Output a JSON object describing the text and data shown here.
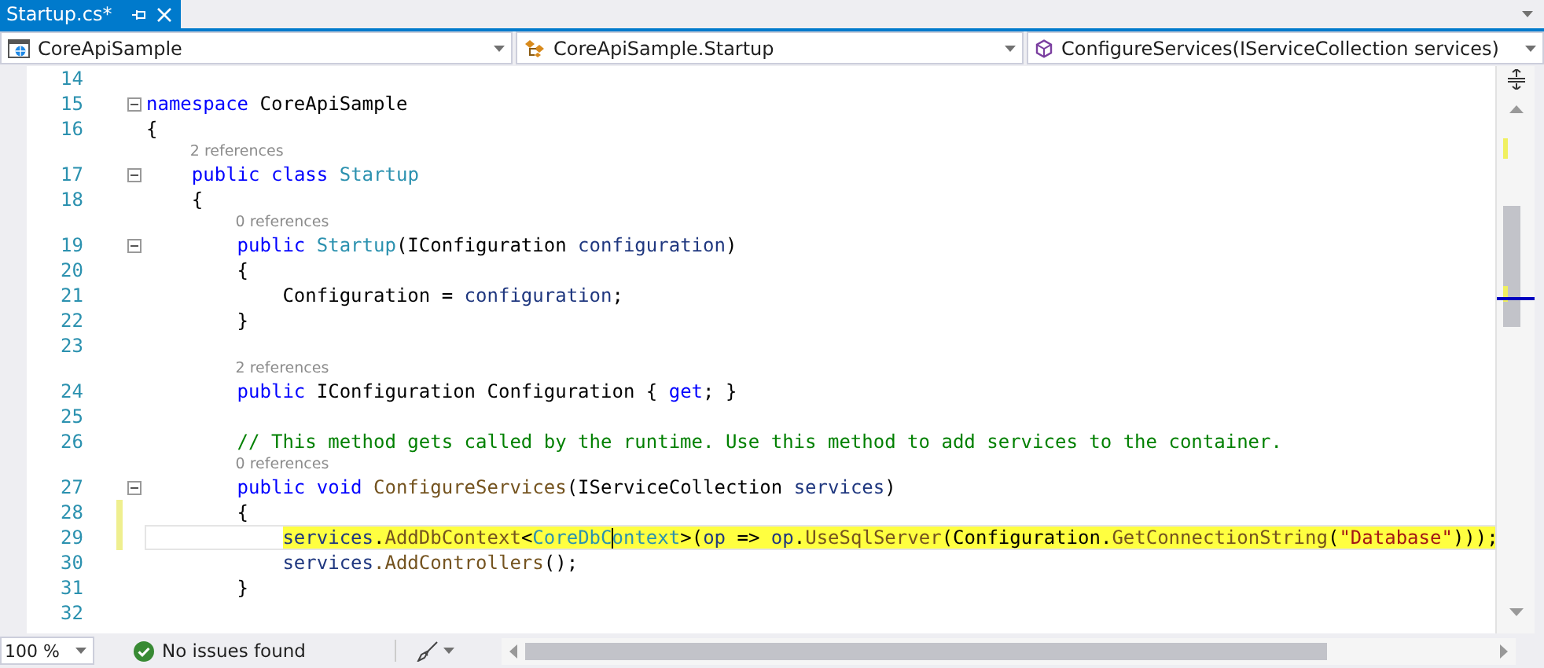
{
  "tab": {
    "title": "Startup.cs*",
    "selected": true
  },
  "navigation": [
    {
      "kind": "project",
      "text": "CoreApiSample"
    },
    {
      "kind": "class",
      "text": "CoreApiSample.Startup"
    },
    {
      "kind": "method",
      "text": "ConfigureServices(IServiceCollection services)"
    }
  ],
  "editor": {
    "lines": [
      {
        "kind": "code",
        "number": "14"
      },
      {
        "kind": "code",
        "number": "15",
        "fold": true,
        "tokens": [
          {
            "kind": "keyword",
            "text": "namespace"
          },
          {
            "kind": "plain",
            "text": " CoreApiSample"
          }
        ]
      },
      {
        "kind": "code",
        "number": "16",
        "tokens": [
          {
            "kind": "plain",
            "text": "{"
          }
        ]
      },
      {
        "kind": "lens",
        "text": "2 references"
      },
      {
        "kind": "code",
        "number": "17",
        "fold": true,
        "tokens": [
          {
            "kind": "keyword",
            "text": "    public"
          },
          {
            "kind": "keyword",
            "text": " class"
          },
          {
            "kind": "type",
            "text": " Startup"
          }
        ]
      },
      {
        "kind": "code",
        "number": "18",
        "tokens": [
          {
            "kind": "plain",
            "text": "    {"
          }
        ]
      },
      {
        "kind": "lens",
        "text": "0 references"
      },
      {
        "kind": "code",
        "number": "19",
        "fold": true,
        "tokens": [
          {
            "kind": "keyword",
            "text": "        public"
          },
          {
            "kind": "type",
            "text": " Startup"
          },
          {
            "kind": "plain",
            "text": "(IConfiguration "
          },
          {
            "kind": "param",
            "text": "configuration"
          },
          {
            "kind": "plain",
            "text": ")"
          }
        ]
      },
      {
        "kind": "code",
        "number": "20",
        "tokens": [
          {
            "kind": "plain",
            "text": "        {"
          }
        ]
      },
      {
        "kind": "code",
        "number": "21",
        "tokens": [
          {
            "kind": "plain",
            "text": "            Configuration = "
          },
          {
            "kind": "param",
            "text": "configuration"
          },
          {
            "kind": "plain",
            "text": ";"
          }
        ]
      },
      {
        "kind": "code",
        "number": "22",
        "tokens": [
          {
            "kind": "plain",
            "text": "        }"
          }
        ]
      },
      {
        "kind": "code",
        "number": "23"
      },
      {
        "kind": "lens",
        "text": "2 references"
      },
      {
        "kind": "code",
        "number": "24",
        "tokens": [
          {
            "kind": "keyword",
            "text": "        public"
          },
          {
            "kind": "plain",
            "text": " IConfiguration Configuration { "
          },
          {
            "kind": "keyword",
            "text": "get"
          },
          {
            "kind": "plain",
            "text": "; }"
          }
        ]
      },
      {
        "kind": "code",
        "number": "25"
      },
      {
        "kind": "code",
        "number": "26",
        "tokens": [
          {
            "kind": "comment",
            "text": "        // This method gets called by the runtime. Use this method to add services to the container."
          }
        ]
      },
      {
        "kind": "lens",
        "text": "0 references"
      },
      {
        "kind": "code",
        "number": "27",
        "fold": true,
        "tokens": [
          {
            "kind": "keyword",
            "text": "        public"
          },
          {
            "kind": "keyword",
            "text": " void"
          },
          {
            "kind": "method",
            "text": " ConfigureServices"
          },
          {
            "kind": "plain",
            "text": "(IServiceCollection "
          },
          {
            "kind": "param",
            "text": "services"
          },
          {
            "kind": "plain",
            "text": ")"
          }
        ]
      },
      {
        "kind": "code",
        "number": "28",
        "changed": true,
        "tokens": [
          {
            "kind": "plain",
            "text": "        {"
          }
        ]
      },
      {
        "kind": "code",
        "number": "29",
        "changed": true,
        "current": true,
        "marked": true,
        "tokens": [
          {
            "kind": "param",
            "text": "            services"
          },
          {
            "kind": "plain",
            "text": "."
          },
          {
            "kind": "method",
            "text": "AddDbContext"
          },
          {
            "kind": "plain",
            "text": "<"
          },
          {
            "kind": "type",
            "text": "CoreDbC"
          },
          {
            "kind": "type",
            "text": "ontext",
            "caret": true
          },
          {
            "kind": "plain",
            "text": ">("
          },
          {
            "kind": "param",
            "text": "op"
          },
          {
            "kind": "plain",
            "text": " => "
          },
          {
            "kind": "param",
            "text": "op"
          },
          {
            "kind": "plain",
            "text": "."
          },
          {
            "kind": "method",
            "text": "UseSqlServer"
          },
          {
            "kind": "plain",
            "text": "(Configuration."
          },
          {
            "kind": "method",
            "text": "GetConnectionString"
          },
          {
            "kind": "plain",
            "text": "("
          },
          {
            "kind": "string",
            "text": "\"Database\""
          },
          {
            "kind": "plain",
            "text": ")));"
          }
        ]
      },
      {
        "kind": "code",
        "number": "30",
        "tokens": [
          {
            "kind": "param",
            "text": "            services"
          },
          {
            "kind": "method",
            "text": ".AddControllers"
          },
          {
            "kind": "plain",
            "text": "();"
          }
        ]
      },
      {
        "kind": "code",
        "number": "31",
        "tokens": [
          {
            "kind": "plain",
            "text": "        }"
          }
        ]
      },
      {
        "kind": "code",
        "number": "32"
      }
    ]
  },
  "status_bar": {
    "zoom": "100 %",
    "issues": "No issues found"
  }
}
